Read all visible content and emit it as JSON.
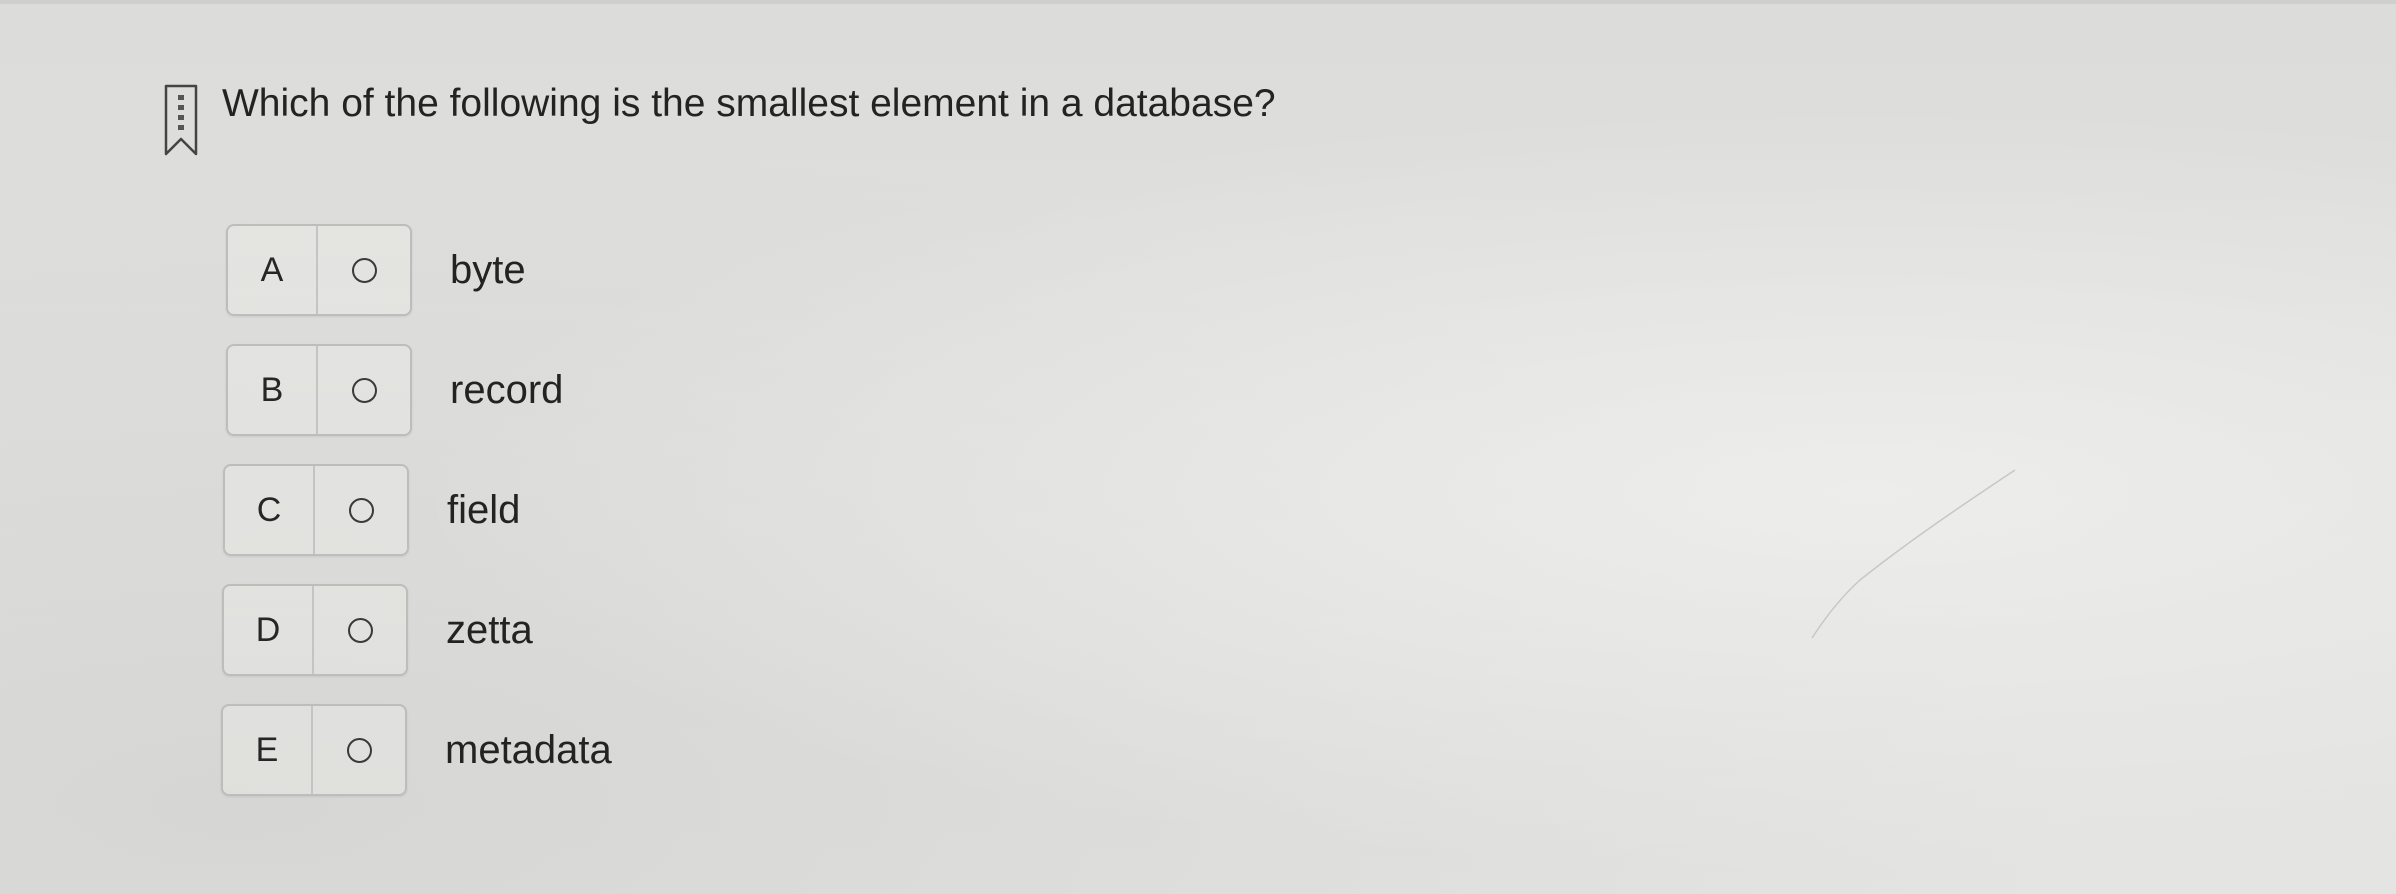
{
  "question": {
    "text": "Which of the following is the smallest element in a database?"
  },
  "options": [
    {
      "letter": "A",
      "text": "byte"
    },
    {
      "letter": "B",
      "text": "record"
    },
    {
      "letter": "C",
      "text": "field"
    },
    {
      "letter": "D",
      "text": "zetta"
    },
    {
      "letter": "E",
      "text": "metadata"
    }
  ],
  "icons": {
    "bookmark": "bookmark-icon",
    "radio": "radio-unselected-icon"
  },
  "colors": {
    "text": "#232323",
    "border": "#bdbdbb",
    "background": "#e0e0de"
  }
}
